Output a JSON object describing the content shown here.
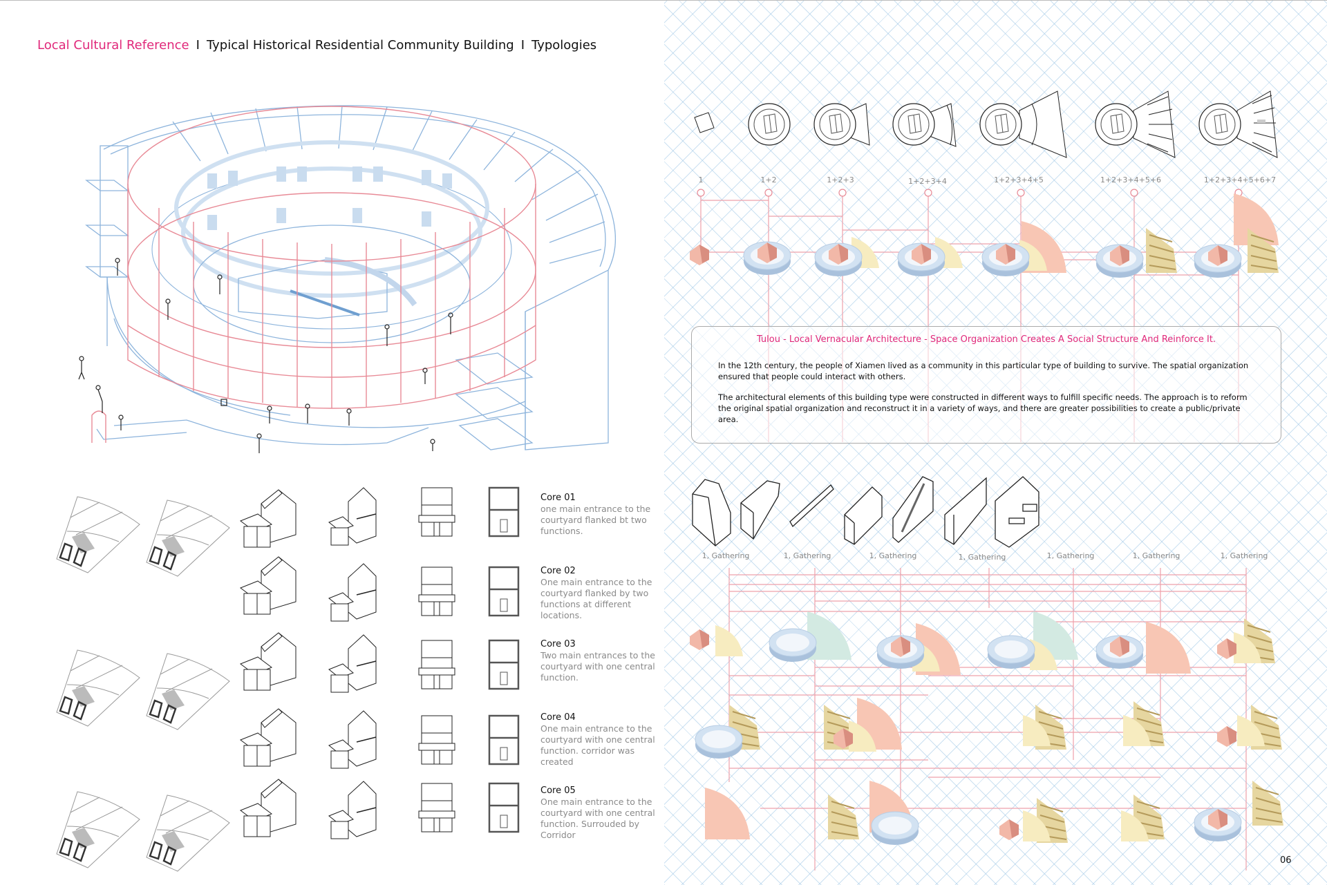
{
  "header": {
    "accent_title": "Local Cultural Reference",
    "separator": "I",
    "subtitle_1": "Typical Historical Residential Community Building",
    "subtitle_2": "Typologies"
  },
  "cores": [
    {
      "title": "Core 01",
      "description": "one main entrance to the courtyard flanked bt two functions."
    },
    {
      "title": "Core 02",
      "description": "One main entrance to the courtyard flanked by two functions at different locations."
    },
    {
      "title": "Core 03",
      "description": "Two main entrances to the courtyard with one central function."
    },
    {
      "title": "Core 04",
      "description": "One main entrance to the courtyard with one central function. corridor was created"
    },
    {
      "title": "Core 05",
      "description": "One main entrance to the courtyard with one central function. Surrouded by Corridor"
    }
  ],
  "typology_formulas": [
    "1",
    "1+2",
    "1+2+3",
    "1+2+3+4",
    "1+2+3+4+5",
    "1+2+3+4+5+6",
    "1+2+3+4+5+6+7"
  ],
  "info_box": {
    "title": "Tulou - Local Vernacular Architecture - Space Organization Creates A Social Structure And Reinforce It.",
    "paragraph_1": "In the 12th century, the people of Xiamen lived as a community in this particular type of building to survive. The spatial organization ensured that people could interact with others.",
    "paragraph_2": "The architectural elements of this building type were constructed in different ways to fulfill specific needs. The approach is to reform the original spatial organization and reconstruct it in a variety of ways, and there are greater possibilities to create a public/private area."
  },
  "components": [
    {
      "label": "1, Gathering",
      "icon": "house-block-icon"
    },
    {
      "label": "1, Gathering",
      "icon": "gable-house-icon"
    },
    {
      "label": "1, Gathering",
      "icon": "beam-icon"
    },
    {
      "label": "1, Gathering",
      "icon": "open-box-icon"
    },
    {
      "label": "1, Gathering",
      "icon": "staircase-icon"
    },
    {
      "label": "1, Gathering",
      "icon": "wall-bench-icon"
    },
    {
      "label": "1, Gathering",
      "icon": "corner-room-icon"
    }
  ],
  "page_number": "06",
  "colors": {
    "accent": "#e0287a",
    "line_blue": "#8db4dc",
    "line_red": "#e88a96",
    "grid_blue": "#a0c8e6",
    "ring_blue": "#c5d8ec",
    "block_pink": "#f2b8a8",
    "fan_yellow": "#f7ecc0",
    "fan_green": "#d3eae2"
  }
}
